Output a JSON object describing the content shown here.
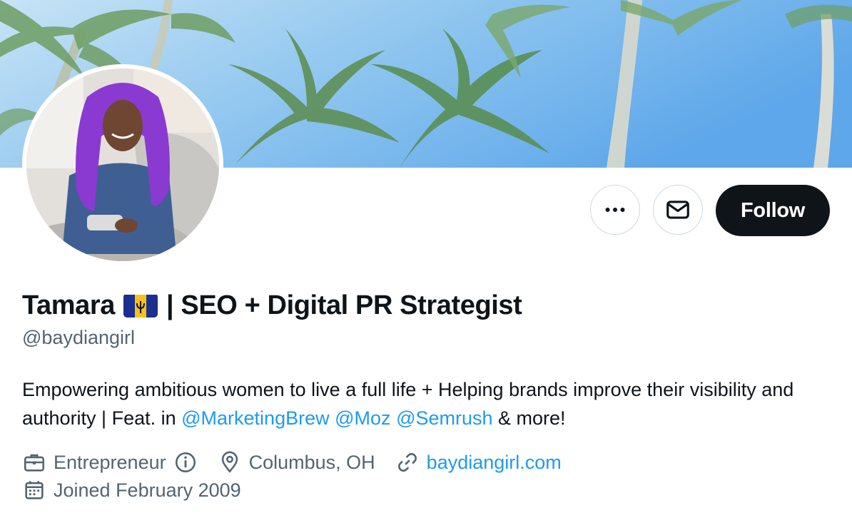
{
  "profile": {
    "display_name_prefix": "Tamara",
    "display_name_suffix": "| SEO + Digital PR Strategist",
    "flag_icon": "barbados-flag-icon",
    "handle": "@baydiangirl"
  },
  "actions": {
    "more_icon": "more-options-icon",
    "message_icon": "envelope-icon",
    "follow_label": "Follow"
  },
  "bio": {
    "text_1": "Empowering ambitious women to live a full life + Helping brands improve their visibility and authority | Feat. in ",
    "mentions": [
      "@MarketingBrew",
      "@Moz",
      "@Semrush"
    ],
    "text_2": " & more!"
  },
  "meta": {
    "category": "Entrepreneur",
    "location": "Columbus, OH",
    "website": "baydiangirl.com",
    "joined": "Joined February 2009"
  },
  "colors": {
    "accent": "#1d9bf0",
    "text_primary": "#0f1419",
    "text_secondary": "#536471",
    "border": "#cfd9de"
  }
}
